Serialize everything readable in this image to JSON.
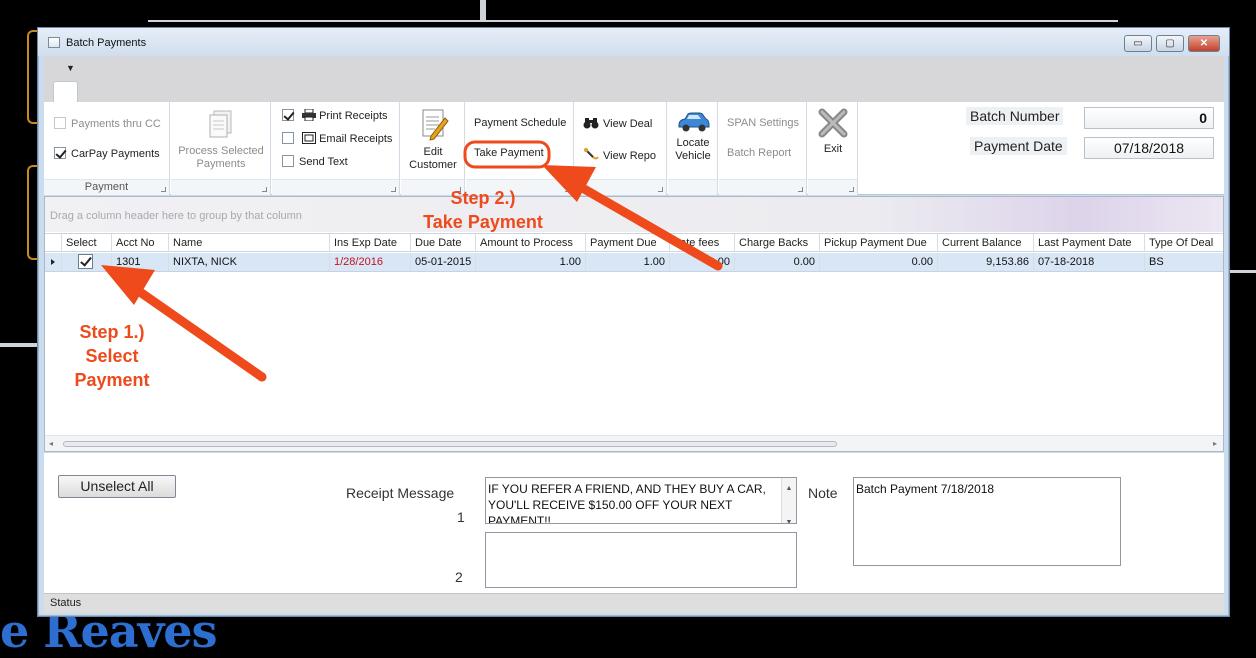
{
  "window": {
    "title": "Batch Payments",
    "controls": {
      "minimize": "▭",
      "maximize": "▢",
      "close": "✕"
    }
  },
  "quick_access": {
    "dropdown_glyph": "▼"
  },
  "ribbon": {
    "payment_group": {
      "label": "Payment",
      "payments_thru_cc": {
        "label": "Payments thru CC",
        "checked": false,
        "enabled": false
      },
      "carpay_payments": {
        "label": "CarPay Payments",
        "checked": true,
        "enabled": true
      }
    },
    "process_group": {
      "process_selected": "Process Selected Payments"
    },
    "receipts_group": {
      "print_receipts": {
        "label": "Print Receipts",
        "checked": true
      },
      "email_receipts": {
        "label": "Email Receipts",
        "checked": false
      },
      "send_text": {
        "label": "Send Text",
        "checked": false
      }
    },
    "edit_customer": "Edit Customer",
    "schedule_group": {
      "payment_schedule": "Payment Schedule",
      "take_payment": "Take Payment"
    },
    "deal_group": {
      "view_deal": "View Deal",
      "view_repo": "View Repo"
    },
    "locate_vehicle": "Locate Vehicle",
    "span_group": {
      "span_settings": "SPAN Settings",
      "batch_report": "Batch Report"
    },
    "exit": "Exit",
    "batch_number": {
      "label": "Batch Number",
      "value": "0"
    },
    "payment_date": {
      "label": "Payment Date",
      "value": "07/18/2018"
    }
  },
  "grid": {
    "group_hint": "Drag a column header here to group by that column",
    "columns": [
      "Select",
      "Acct No",
      "Name",
      "Ins Exp Date",
      "Due Date",
      "Amount to Process",
      "Payment Due",
      "Late fees",
      "Charge Backs",
      "Pickup Payment Due",
      "Current Balance",
      "Last Payment Date",
      "Type Of Deal"
    ],
    "rows": [
      {
        "selected": true,
        "acct_no": "1301",
        "name": "NIXTA, NICK",
        "ins_exp_date": "1/28/2016",
        "due_date": "05-01-2015",
        "amount_to_process": "1.00",
        "payment_due": "1.00",
        "late_fees": "0.00",
        "charge_backs": "0.00",
        "pickup_payment_due": "0.00",
        "current_balance": "9,153.86",
        "last_payment_date": "07-18-2018",
        "type_of_deal": "BS"
      }
    ]
  },
  "bottom": {
    "unselect_all": "Unselect All",
    "receipt_message_label": "Receipt Message",
    "line1_label": "1",
    "line2_label": "2",
    "receipt_message_1": "IF YOU REFER A FRIEND, AND THEY BUY A CAR, YOU'LL RECEIVE $150.00 OFF YOUR NEXT PAYMENT!!",
    "receipt_message_2": "",
    "note_label": "Note",
    "note_value": "Batch Payment 7/18/2018"
  },
  "status": {
    "text": "Status"
  },
  "annotations": {
    "step1_line1": "Step 1.)",
    "step1_line2": "Select",
    "step1_line3": "Payment",
    "step2_line1": "Step 2.)",
    "step2_line2": "Take Payment",
    "color": "#ee4a1c"
  },
  "background": {
    "logo_text": "e Reaves",
    "accent": "#2c6fd1"
  }
}
